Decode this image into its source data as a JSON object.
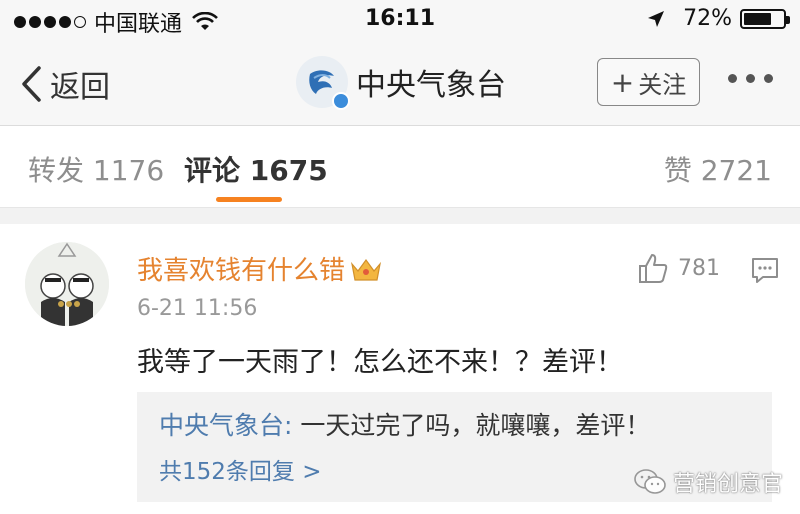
{
  "status_bar": {
    "carrier": "中国联通",
    "time": "16:11",
    "battery_percent": "72%",
    "battery_level": 0.72
  },
  "nav": {
    "back_label": "返回",
    "title": "中央气象台",
    "follow_label": "关注",
    "follow_plus": "+"
  },
  "tabs": {
    "repost_label": "转发",
    "repost_count": "1176",
    "comment_label": "评论",
    "comment_count": "1675",
    "like_label": "赞",
    "like_count": "2721"
  },
  "comment": {
    "username": "我喜欢钱有什么错",
    "time": "6-21 11:56",
    "likes": "781",
    "text": "我等了一天雨了！怎么还不来！？差评！",
    "reply": {
      "author": "中央气象台:",
      "text": " 一天过完了吗，就嚷嚷，差评！",
      "more_label": "共152条回复 >"
    }
  },
  "watermark": {
    "text": "营销创意官"
  },
  "colors": {
    "accent": "#f68220",
    "username": "#e5832f",
    "link": "#4f7cae"
  },
  "icons": [
    "signal-icon",
    "wifi-icon",
    "location-arrow-icon",
    "battery-icon",
    "back-chevron-icon",
    "cma-logo-icon",
    "verified-icon",
    "plus-icon",
    "more-icon",
    "vip-crown-icon",
    "thumbs-up-icon",
    "reply-comment-icon",
    "wechat-icon"
  ]
}
